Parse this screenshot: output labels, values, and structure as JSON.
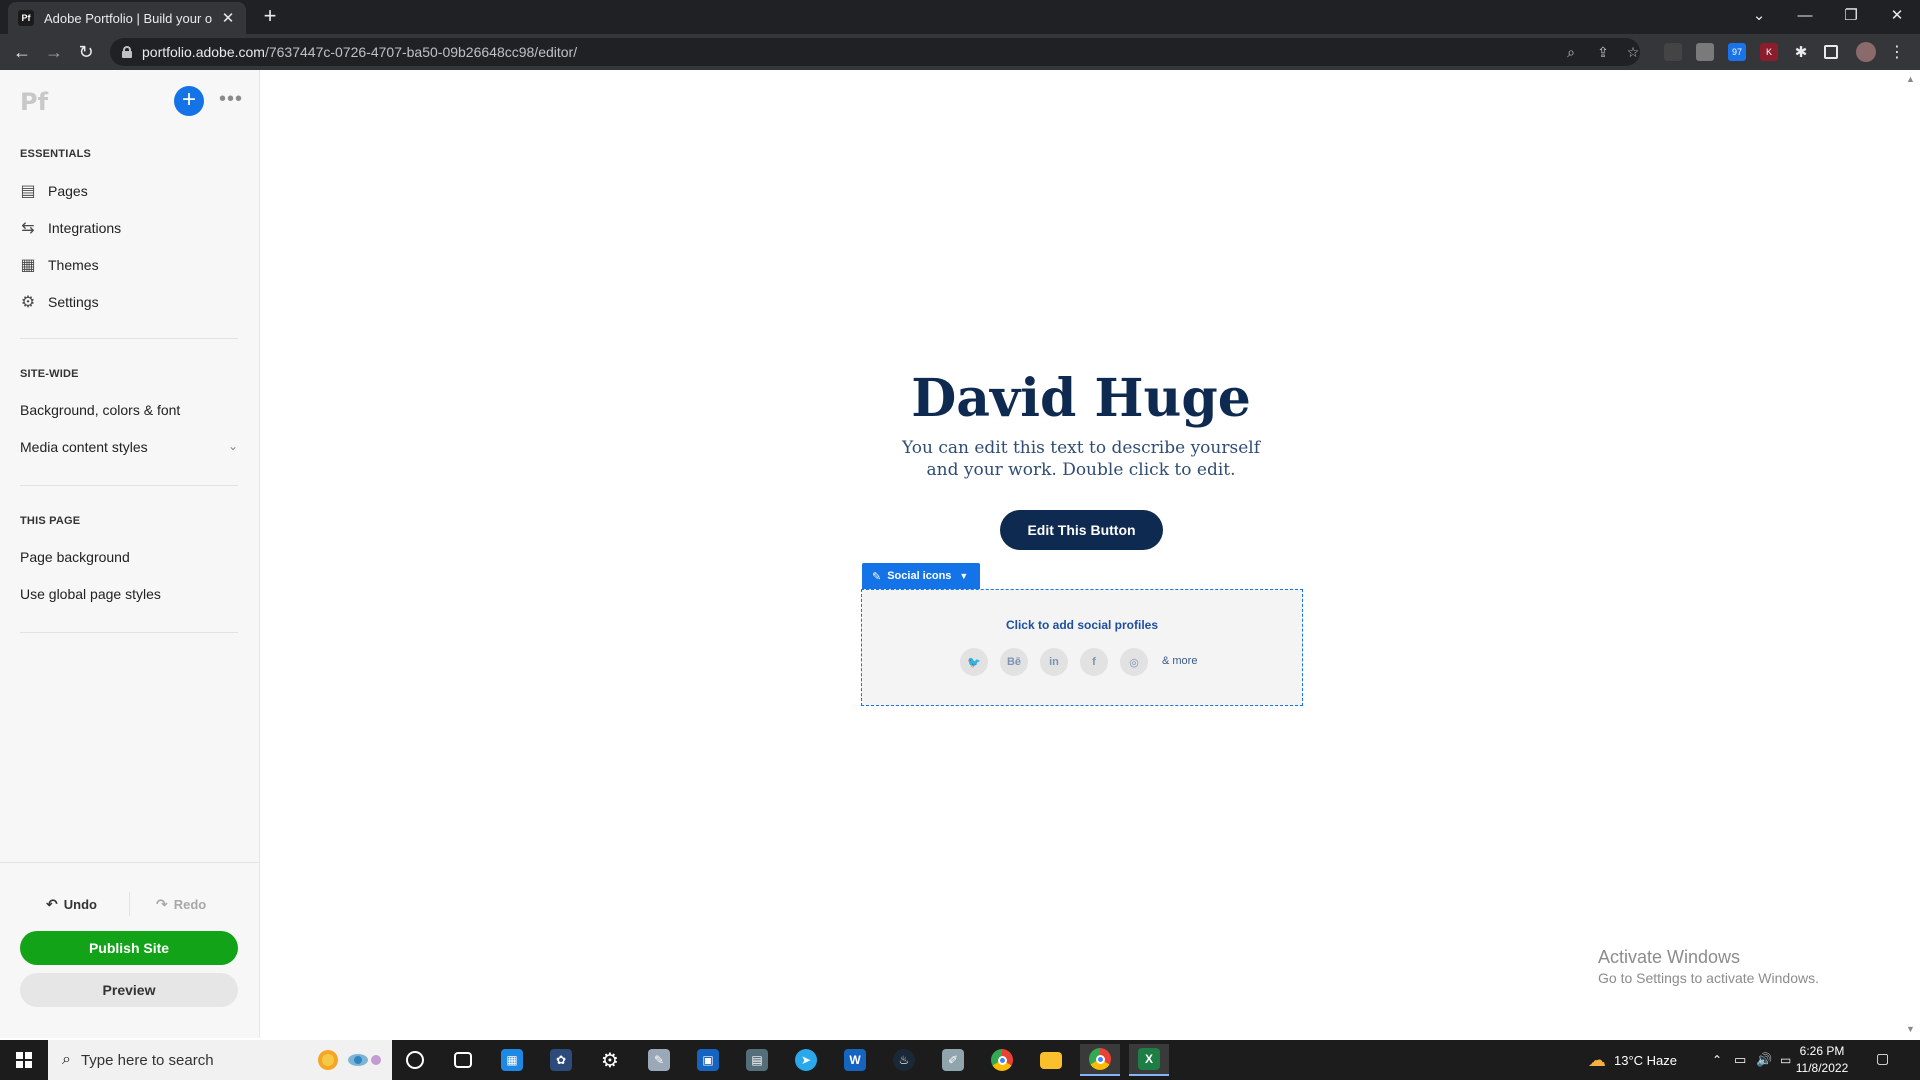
{
  "browser": {
    "tab_title": "Adobe Portfolio | Build your own",
    "tab_favicon": "Pf",
    "url_host": "portfolio.adobe.com",
    "url_path": "/7637447c-0726-4707-ba50-09b26648cc98/editor/",
    "ext_badge": "97"
  },
  "sidebar": {
    "logo": "Pf",
    "essentials_title": "ESSENTIALS",
    "essentials": [
      {
        "label": "Pages",
        "icon": "page-icon"
      },
      {
        "label": "Integrations",
        "icon": "integrations-icon"
      },
      {
        "label": "Themes",
        "icon": "themes-icon"
      },
      {
        "label": "Settings",
        "icon": "gear-icon"
      }
    ],
    "sitewide_title": "SITE-WIDE",
    "sitewide": [
      "Background, colors & font",
      "Media content styles"
    ],
    "thispage_title": "THIS PAGE",
    "thispage": [
      "Page background",
      "Use global page styles"
    ],
    "undo": "Undo",
    "redo": "Redo",
    "publish": "Publish Site",
    "preview": "Preview"
  },
  "canvas": {
    "name": "David Huge",
    "description": "You can edit this text to describe yourself and your work. Double click to edit.",
    "button_label": "Edit This Button",
    "social_tag": "Social icons",
    "social_cta": "Click to add social profiles",
    "social_icons": [
      {
        "name": "twitter-icon",
        "glyph": "🐦"
      },
      {
        "name": "behance-icon",
        "glyph": "Bē"
      },
      {
        "name": "linkedin-icon",
        "glyph": "in"
      },
      {
        "name": "facebook-icon",
        "glyph": "f"
      },
      {
        "name": "instagram-icon",
        "glyph": "◎"
      }
    ],
    "social_more": "& more"
  },
  "watermark": {
    "title": "Activate Windows",
    "subtitle": "Go to Settings to activate Windows."
  },
  "taskbar": {
    "search_placeholder": "Type here to search",
    "weather": "13°C  Haze",
    "time": "6:26 PM",
    "date": "11/8/2022"
  },
  "colors": {
    "accent_blue": "#1473e6",
    "publish_green": "#12a318",
    "hero_navy": "#0e2a50"
  }
}
